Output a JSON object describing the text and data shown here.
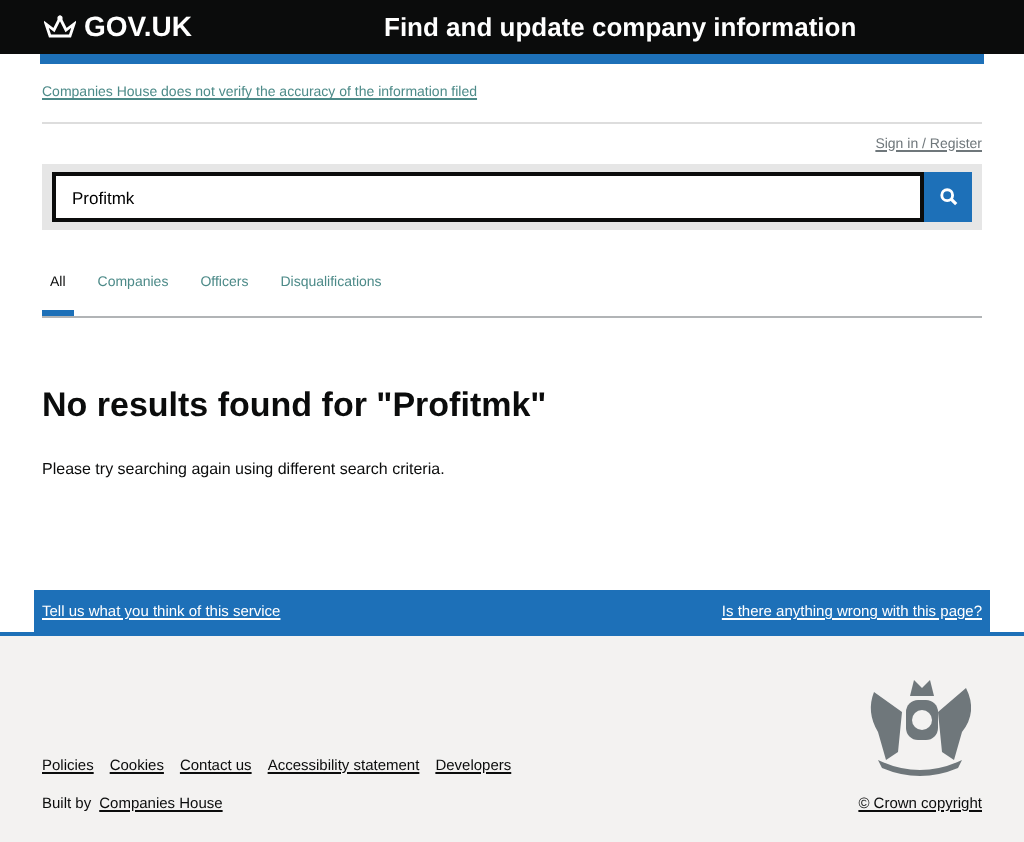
{
  "header": {
    "logo": "GOV.UK",
    "title": "Find and update company information"
  },
  "notice": "Companies House does not verify the accuracy of the information filed",
  "sign_in": "Sign in / Register",
  "search": {
    "value": "Profitmk"
  },
  "tabs": [
    {
      "label": "All",
      "selected": true
    },
    {
      "label": "Companies",
      "selected": false
    },
    {
      "label": "Officers",
      "selected": false
    },
    {
      "label": "Disqualifications",
      "selected": false
    }
  ],
  "heading": "No results found for \"Profitmk\"",
  "message": "Please try searching again using different search criteria.",
  "feedback": {
    "left": "Tell us what you think of this service",
    "right": "Is there anything wrong with this page?"
  },
  "footer": {
    "links": [
      "Policies",
      "Cookies",
      "Contact us",
      "Accessibility statement",
      "Developers"
    ],
    "built_by": "Built by",
    "built_by_link": "Companies House",
    "copyright": "© Crown copyright"
  }
}
